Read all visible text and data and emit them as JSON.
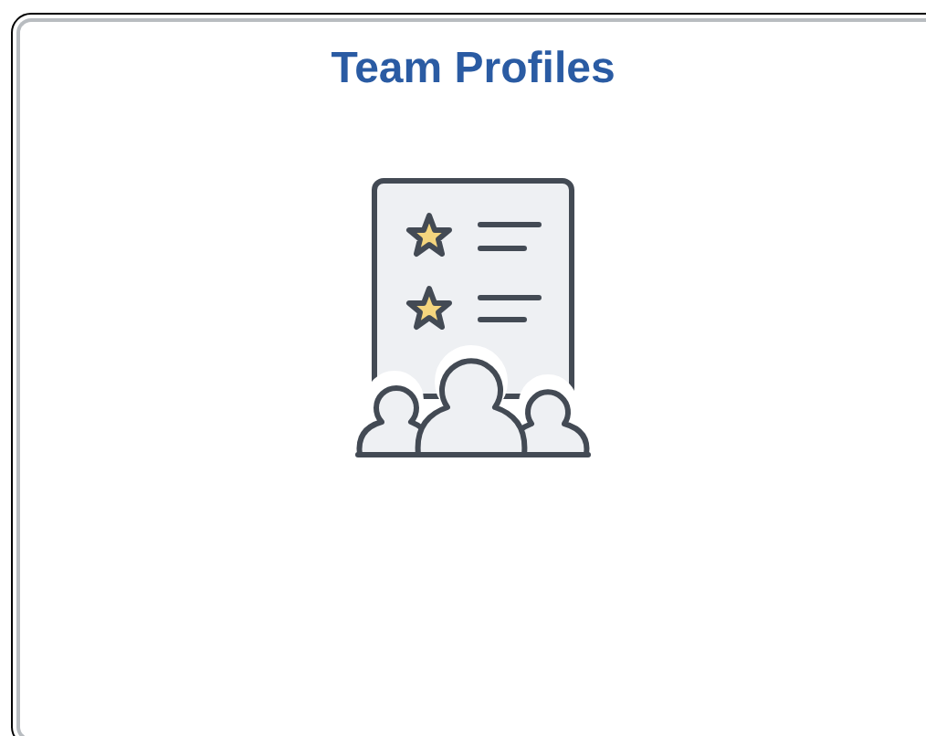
{
  "tile": {
    "title": "Team Profiles"
  }
}
